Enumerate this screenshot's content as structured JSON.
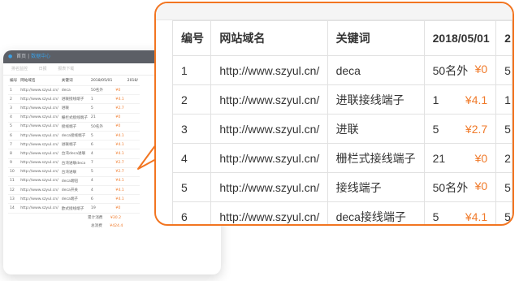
{
  "mini": {
    "breadcrumb_home": "首页",
    "breadcrumb_sep": "|",
    "breadcrumb_active": "数据中心",
    "tabs": [
      "排名监控",
      "日报",
      "报表下载"
    ],
    "headers": [
      "编号",
      "网站域名",
      "关键词",
      "2018/05/01",
      "2018/"
    ],
    "rows": [
      [
        "1",
        "http://www.szyul.cn/",
        "deca",
        "50名外",
        "¥0"
      ],
      [
        "2",
        "http://www.szyul.cn/",
        "进联接线端子",
        "1",
        "¥4.1"
      ],
      [
        "3",
        "http://www.szyul.cn/",
        "进联",
        "5",
        "¥2.7"
      ],
      [
        "4",
        "http://www.szyul.cn/",
        "栅栏式接线端子",
        "21",
        "¥0"
      ],
      [
        "5",
        "http://www.szyul.cn/",
        "接线端子",
        "50名外",
        "¥0"
      ],
      [
        "6",
        "http://www.szyul.cn/",
        "deca接线端子",
        "5",
        "¥4.1"
      ],
      [
        "7",
        "http://www.szyul.cn/",
        "进联端子",
        "6",
        "¥4.1"
      ],
      [
        "8",
        "http://www.szyul.cn/",
        "台湾deca进联",
        "4",
        "¥4.1"
      ],
      [
        "9",
        "http://www.szyul.cn/",
        "台湾进联deca",
        "7",
        "¥2.7"
      ],
      [
        "10",
        "http://www.szyul.cn/",
        "台湾进联",
        "5",
        "¥2.7"
      ],
      [
        "11",
        "http://www.szyul.cn/",
        "deca端钮",
        "4",
        "¥4.1"
      ],
      [
        "12",
        "http://www.szyul.cn/",
        "deca开关",
        "4",
        "¥4.1"
      ],
      [
        "13",
        "http://www.szyul.cn/",
        "deca端子",
        "6",
        "¥4.1"
      ],
      [
        "14",
        "http://www.szyul.cn/",
        "欧式接线端子",
        "19",
        "¥0"
      ]
    ],
    "footer_label_1": "累计消费",
    "footer_value_1": "¥30.2",
    "footer_label_2": "总消费",
    "footer_value_2": "¥424.4"
  },
  "table": {
    "headers": [
      "编号",
      "网站域名",
      "关键词",
      "2018/05/01",
      "2"
    ],
    "rows": [
      {
        "id": "1",
        "domain": "http://www.szyul.cn/",
        "keyword": "deca",
        "rank": "50名外",
        "cost": "¥0",
        "next": "5"
      },
      {
        "id": "2",
        "domain": "http://www.szyul.cn/",
        "keyword": "进联接线端子",
        "rank": "1",
        "cost": "¥4.1",
        "next": "1"
      },
      {
        "id": "3",
        "domain": "http://www.szyul.cn/",
        "keyword": "进联",
        "rank": "5",
        "cost": "¥2.7",
        "next": "5"
      },
      {
        "id": "4",
        "domain": "http://www.szyul.cn/",
        "keyword": "栅栏式接线端子",
        "rank": "21",
        "cost": "¥0",
        "next": "2"
      },
      {
        "id": "5",
        "domain": "http://www.szyul.cn/",
        "keyword": "接线端子",
        "rank": "50名外",
        "cost": "¥0",
        "next": "5"
      },
      {
        "id": "6",
        "domain": "http://www.szyul.cn/",
        "keyword": "deca接线端子",
        "rank": "5",
        "cost": "¥4.1",
        "next": "5"
      }
    ]
  },
  "colors": {
    "accent": "#f27521",
    "price": "#f07a2a",
    "header_bar": "#5c5f66",
    "link": "#3aa0e6"
  }
}
